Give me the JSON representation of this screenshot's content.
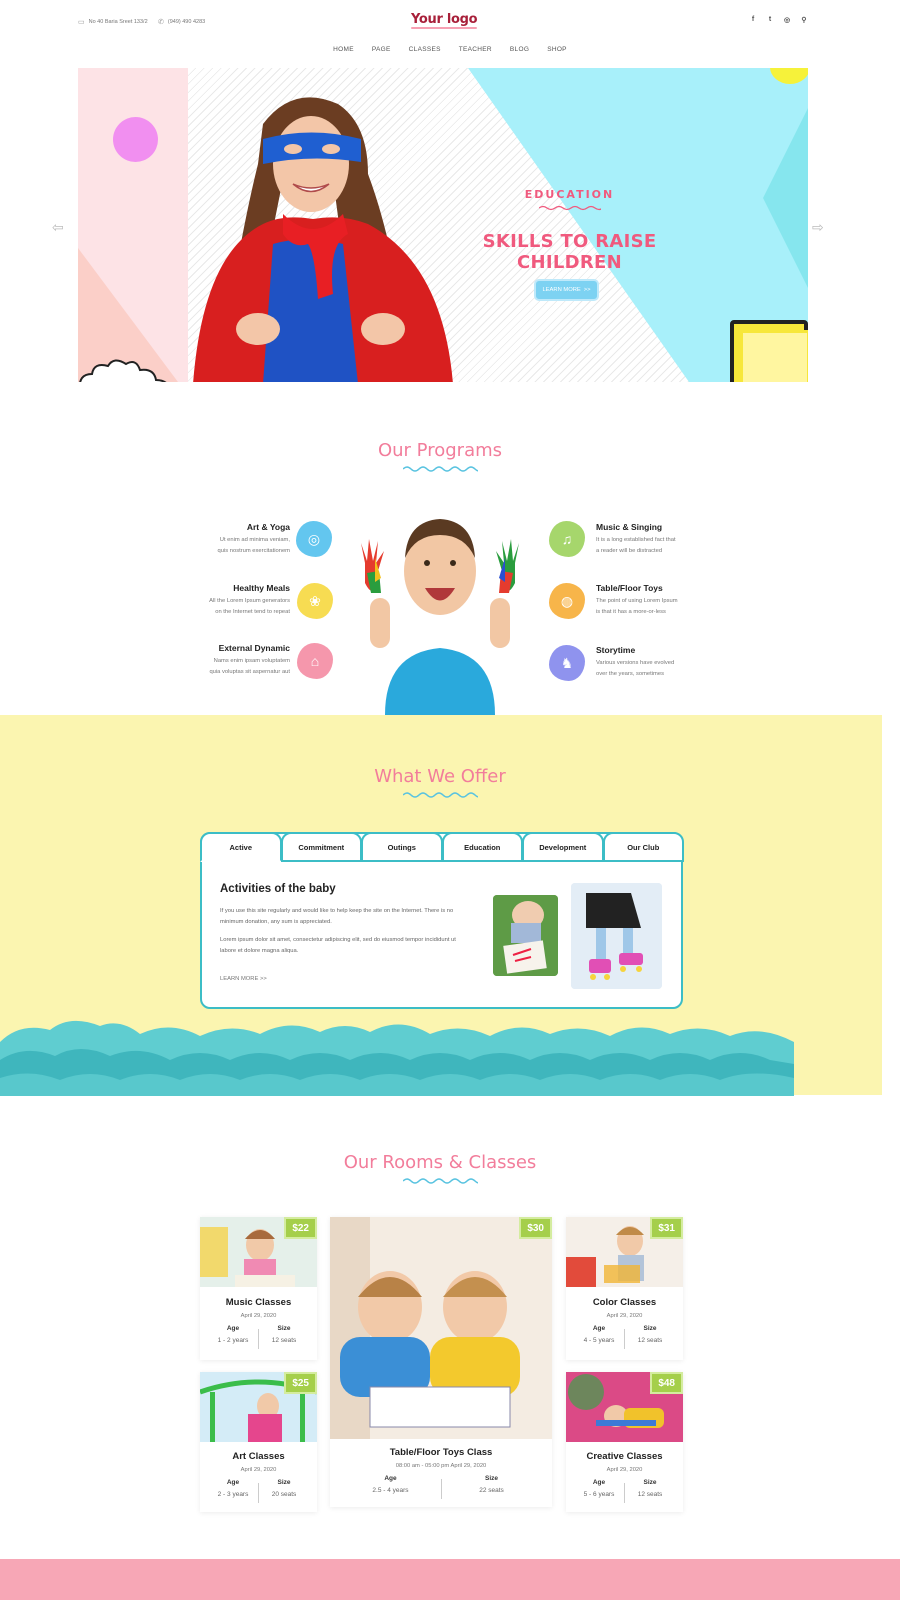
{
  "topbar": {
    "address": "No 40 Baria Sreet 133/2",
    "phone": "(949) 490 4283",
    "logo": "Your logo",
    "social": [
      "f",
      "t",
      "ig",
      "search"
    ]
  },
  "nav": [
    "HOME",
    "PAGE",
    "CLASSES",
    "TEACHER",
    "BLOG",
    "SHOP"
  ],
  "hero": {
    "eyebrow": "EDUCATION",
    "title": "SKILLS TO RAISE CHILDREN",
    "button": "LEARN MORE",
    "button_arrow": ">>",
    "prev": "⇦",
    "next": "⇨"
  },
  "programs": {
    "title": "Our Programs",
    "left": [
      {
        "title": "Art & Yoga",
        "desc1": "Ut enim ad minima veniam,",
        "desc2": "quis nostrum exercitationem",
        "color": "#63c6ef",
        "icon": "target-icon"
      },
      {
        "title": "Healthy Meals",
        "desc1": "All the Lorem Ipsum generators",
        "desc2": "on the Internet tend to repeat",
        "color": "#f7dc52",
        "icon": "meal-icon"
      },
      {
        "title": "External Dynamic",
        "desc1": "Nams enim ipsam voluptatem",
        "desc2": "quia voluptas sit aspernatur aut",
        "color": "#f597ac",
        "icon": "tent-icon"
      }
    ],
    "right": [
      {
        "title": "Music & Singing",
        "desc1": "It is a long established fact that",
        "desc2": "a reader will be distracted",
        "color": "#a6d66c",
        "icon": "music-icon"
      },
      {
        "title": "Table/Floor Toys",
        "desc1": "The point of using Lorem Ipsum",
        "desc2": "is that it has a more-or-less",
        "color": "#f7b54a",
        "icon": "ball-icon"
      },
      {
        "title": "Storytime",
        "desc1": "Various versions have evolved",
        "desc2": "over the years, sometimes",
        "color": "#8f93ee",
        "icon": "horse-icon"
      }
    ]
  },
  "offer": {
    "title": "What We Offer",
    "tabs": [
      "Active",
      "Commitment",
      "Outings",
      "Education",
      "Development",
      "Our Club"
    ],
    "heading": "Activities of the baby",
    "p1a": "If you use this site regularly and would like to help keep the site on the Internet. There",
    "p1b": "is no minimum donation, any sum is appreciated.",
    "p2a": "Lorem ipsum dolor sit amet, consectetur adipiscing elit, sed do eiusmod tempor",
    "p2b": "incididunt ut labore et dolore magna aliqua.",
    "more": "LEARN MORE  >>"
  },
  "rooms": {
    "title": "Our Rooms & Classes",
    "age_label": "Age",
    "size_label": "Size",
    "cards": [
      {
        "title": "Music Classes",
        "date": "April 29, 2020",
        "price": "$22",
        "age": "1 - 2 years",
        "size": "12 seats"
      },
      {
        "title": "Table/Floor Toys Class",
        "date": "08:00 am - 05:00 pm    April 29, 2020",
        "price": "$30",
        "age": "2.5 - 4 years",
        "size": "22 seats"
      },
      {
        "title": "Color Classes",
        "date": "April 29, 2020",
        "price": "$31",
        "age": "4 - 5 years",
        "size": "12 seats"
      },
      {
        "title": "Art Classes",
        "date": "April 29, 2020",
        "price": "$25",
        "age": "2 - 3 years",
        "size": "20 seats"
      },
      {
        "title": "Creative Classes",
        "date": "April 29, 2020",
        "price": "$48",
        "age": "5 - 6 years",
        "size": "12 seats"
      }
    ]
  },
  "colors": {
    "accent_pink": "#f27d9b",
    "teal": "#3cbdc6",
    "yellow_bg": "#fbf5b0",
    "price_green": "#a5cf4b"
  }
}
